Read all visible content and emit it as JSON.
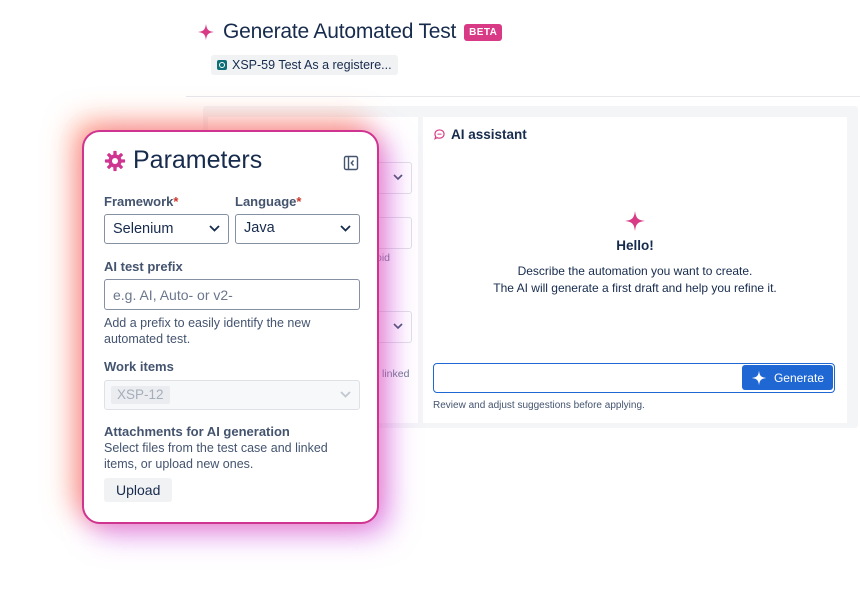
{
  "header": {
    "title": "Generate Automated Test",
    "badge": "BETA",
    "work_item_chip": "XSP-59 Test As a registere..."
  },
  "background_form": {
    "fragment_1": "oid",
    "fragment_2": "linked"
  },
  "assistant": {
    "title": "AI assistant",
    "greeting": "Hello!",
    "description_line1": "Describe the automation you want to create.",
    "description_line2": "The AI will generate a first draft and help you refine it.",
    "prompt_value": "",
    "prompt_placeholder": "",
    "generate_label": "Generate",
    "review_note": "Review and adjust suggestions before applying."
  },
  "parameters": {
    "title": "Parameters",
    "framework_label": "Framework",
    "framework_value": "Selenium",
    "language_label": "Language",
    "language_value": "Java",
    "required_marker": "*",
    "prefix_label": "AI test prefix",
    "prefix_value": "",
    "prefix_placeholder": "e.g. AI, Auto- or v2-",
    "prefix_helper": "Add a prefix to easily identify the new automated test.",
    "work_items_label": "Work items",
    "work_items_value": "XSP-12",
    "attachments_title": "Attachments for AI generation",
    "attachments_desc": "Select files from the test case and linked items, or upload new ones.",
    "upload_label": "Upload"
  },
  "icons": {
    "sparkle": "sparkle-icon",
    "gear": "gear-icon",
    "collapse": "collapse-panel-icon",
    "chevron": "chevron-down-icon",
    "chat": "chat-bubble-icon",
    "work_item": "test-issue-icon"
  },
  "colors": {
    "brand_magenta": "#cf3590",
    "primary_blue": "#1f67d3",
    "glow_orange": "#ff7846",
    "glow_purple": "#c846eb"
  }
}
